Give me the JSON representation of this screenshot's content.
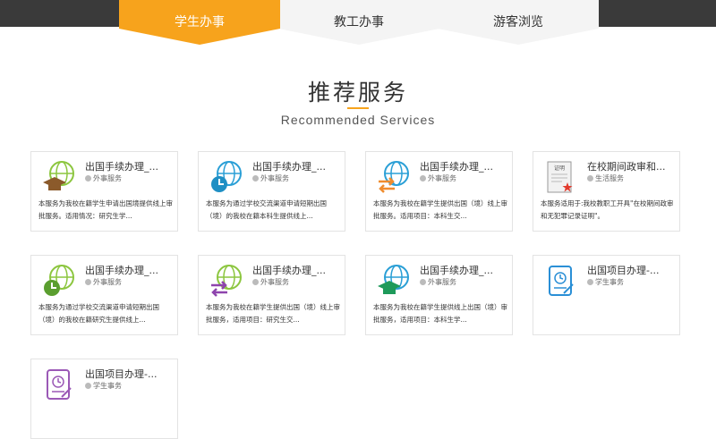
{
  "tabs": [
    {
      "label": "学生办事",
      "active": true
    },
    {
      "label": "教工办事",
      "active": false
    },
    {
      "label": "游客浏览",
      "active": false
    }
  ],
  "section": {
    "title": "推荐服务",
    "subtitle": "Recommended Services"
  },
  "cards": [
    {
      "icon": "graduation-cap-globe-icon",
      "name": "出国手续办理_...",
      "category": "外事服务",
      "desc": "本服务为我校在籍学生申请出国境提供线上审批服务。适用情况：研究生学..."
    },
    {
      "icon": "clock-globe-icon",
      "name": "出国手续办理_...",
      "category": "外事服务",
      "desc": "本服务为通过学校交流渠道申请短期出国（境）的我校在籍本科生提供线上..."
    },
    {
      "icon": "exchange-arrows-globe-icon",
      "name": "出国手续办理_...",
      "category": "外事服务",
      "desc": "本服务为我校在籍学生提供出国（境）线上审批服务。适用项目：本科生交..."
    },
    {
      "icon": "certificate-icon",
      "name": "在校期间政审和...",
      "category": "生活服务",
      "desc": "本服务适用于:我校教职工开具\"在校期间政审和无犯罪记录证明\"。"
    },
    {
      "icon": "clock-globe-icon",
      "name": "出国手续办理_...",
      "category": "外事服务",
      "desc": "本服务为通过学校交流渠道申请短期出国（境）的我校在籍研究生提供线上..."
    },
    {
      "icon": "exchange-arrows-globe-icon",
      "name": "出国手续办理_...",
      "category": "外事服务",
      "desc": "本服务为我校在籍学生提供出国（境）线上审批服务，适用项目：研究生交..."
    },
    {
      "icon": "graduation-cap-globe-icon",
      "name": "出国手续办理_...",
      "category": "外事服务",
      "desc": "本服务为我校在籍学生提供线上出国（境）审批服务，适用项目：本科生学..."
    },
    {
      "icon": "project-document-icon",
      "name": "出国项目办理-...",
      "category": "学生事务",
      "desc": ""
    },
    {
      "icon": "project-document-icon",
      "name": "出国项目办理-...",
      "category": "学生事务",
      "desc": ""
    }
  ],
  "certificate_stamp_text": "证明",
  "colors": {
    "accent": "#f7a31c",
    "topbar": "#3a3a3a",
    "globe_green": "#8cc63f",
    "globe_blue": "#2a9fd6",
    "cap_brown": "#8b5a2b",
    "clock_green": "#5a9e2f",
    "clock_blue": "#1f8fc4",
    "arrow_orange": "#f08c2e",
    "arrow_purple": "#8e44ad",
    "cap_green": "#1e9a5a",
    "doc_blue": "#2a8fd6",
    "doc_purple": "#9b59b6"
  }
}
